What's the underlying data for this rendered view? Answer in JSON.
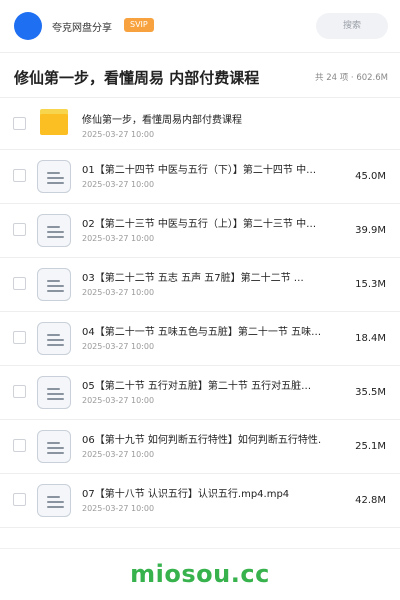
{
  "header": {
    "username": "夸克网盘分享",
    "badge": "SVIP",
    "search_placeholder": "搜索"
  },
  "folder": {
    "title": "修仙第一步，看懂周易 内部付费课程",
    "meta": "共 24 项 · 602.6M"
  },
  "items": [
    {
      "type": "folder",
      "name": "修仙第一步，看懂周易内部付费课程",
      "date": "2025-03-27 10:00",
      "size": ""
    },
    {
      "type": "file",
      "name": "01【第二十四节 中医与五行（下）】第二十四节 中…",
      "date": "2025-03-27 10:00",
      "size": "45.0M"
    },
    {
      "type": "file",
      "name": "02【第二十三节 中医与五行（上）】第二十三节 中…",
      "date": "2025-03-27 10:00",
      "size": "39.9M"
    },
    {
      "type": "file",
      "name": "03【第二十二节 五志 五声 五7脏】第二十二节 …",
      "date": "2025-03-27 10:00",
      "size": "15.3M"
    },
    {
      "type": "file",
      "name": "04【第二十一节 五味五色与五脏】第二十一节 五味…",
      "date": "2025-03-27 10:00",
      "size": "18.4M"
    },
    {
      "type": "file",
      "name": "05【第二十节 五行对五脏】第二十节 五行对五脏…",
      "date": "2025-03-27 10:00",
      "size": "35.5M"
    },
    {
      "type": "file",
      "name": "06【第十九节 如何判断五行特性】如何判断五行特性…",
      "date": "2025-03-27 10:00",
      "size": "25.1M"
    },
    {
      "type": "file",
      "name": "07【第十八节 认识五行】认识五行.mp4.mp4",
      "date": "2025-03-27 10:00",
      "size": "42.8M"
    }
  ],
  "watermark": "miosou.cc",
  "colors": {
    "avatar": "#1f6ff2",
    "badge": "#f7a23e",
    "folder_icon": "#fbbf24",
    "watermark": "#37b24d"
  }
}
